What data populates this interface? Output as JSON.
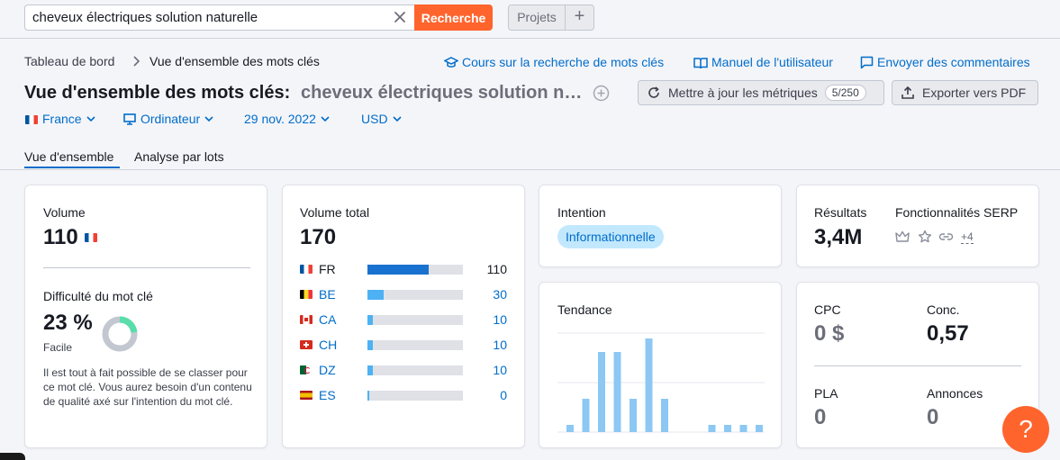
{
  "search": {
    "value": "cheveux électriques solution naturelle",
    "button_label": "Recherche",
    "projects_label": "Projets",
    "add_label": "+"
  },
  "breadcrumb": {
    "home": "Tableau de bord",
    "current": "Vue d'ensemble des mots clés"
  },
  "header_links": {
    "course": "Cours sur la recherche de mots clés",
    "manual": "Manuel de l'utilisateur",
    "feedback": "Envoyer des commentaires"
  },
  "title": {
    "main": "Vue d'ensemble des mots clés:",
    "keyword": "cheveux électriques solution naturelle"
  },
  "actions": {
    "update_label": "Mettre à jour les métriques",
    "update_count": "5/250",
    "export_label": "Exporter vers PDF"
  },
  "filters": {
    "country": "France",
    "device": "Ordinateur",
    "date": "29 nov. 2022",
    "currency": "USD"
  },
  "tabs": [
    "Vue d'ensemble",
    "Analyse par lots"
  ],
  "volume_card": {
    "label": "Volume",
    "value": "110",
    "difficulty_label": "Difficulté du mot clé",
    "difficulty_value": "23 %",
    "difficulty_percent": 23,
    "difficulty_level": "Facile",
    "description": "Il est tout à fait possible de se classer pour ce mot clé. Vous aurez besoin d'un contenu de qualité axé sur l'intention du mot clé."
  },
  "total_volume_card": {
    "label": "Volume total",
    "value": "170",
    "countries": [
      {
        "code": "FR",
        "flag": "fr",
        "value": "110",
        "share": 0.64,
        "link": false
      },
      {
        "code": "BE",
        "flag": "be",
        "value": "30",
        "share": 0.17,
        "link": true
      },
      {
        "code": "CA",
        "flag": "ca",
        "value": "10",
        "share": 0.06,
        "link": true
      },
      {
        "code": "CH",
        "flag": "ch",
        "value": "10",
        "share": 0.06,
        "link": true
      },
      {
        "code": "DZ",
        "flag": "dz",
        "value": "10",
        "share": 0.06,
        "link": true
      },
      {
        "code": "ES",
        "flag": "es",
        "value": "0",
        "share": 0.02,
        "link": true
      }
    ]
  },
  "intent_card": {
    "label": "Intention",
    "value": "Informationnelle"
  },
  "trend_card": {
    "label": "Tendance",
    "bars": [
      0.08,
      0.36,
      0.86,
      0.86,
      0.36,
      1.0,
      0.36,
      0,
      0.08,
      0.08,
      0.08,
      0.08
    ]
  },
  "results_card": {
    "results_label": "Résultats",
    "results_value": "3,4M",
    "serp_label": "Fonctionnalités SERP",
    "serp_more": "+4",
    "serp_icons": [
      "crown-icon",
      "star-icon",
      "link-icon"
    ]
  },
  "cpc_card": {
    "cpc_label": "CPC",
    "cpc_value": "0 $",
    "comp_label": "Conc.",
    "comp_value": "0,57",
    "pla_label": "PLA",
    "pla_value": "0",
    "ads_label": "Annonces",
    "ads_value": "0"
  },
  "help": {
    "label": "?"
  },
  "colors": {
    "accent": "#ff642d",
    "link": "#006dca",
    "bar_primary": "#1a72d0",
    "bar_secondary": "#4eb1f4",
    "trend_bar": "#8cc8f3",
    "difficulty_green": "#59ddaa",
    "difficulty_gray": "#c2c7d0"
  }
}
